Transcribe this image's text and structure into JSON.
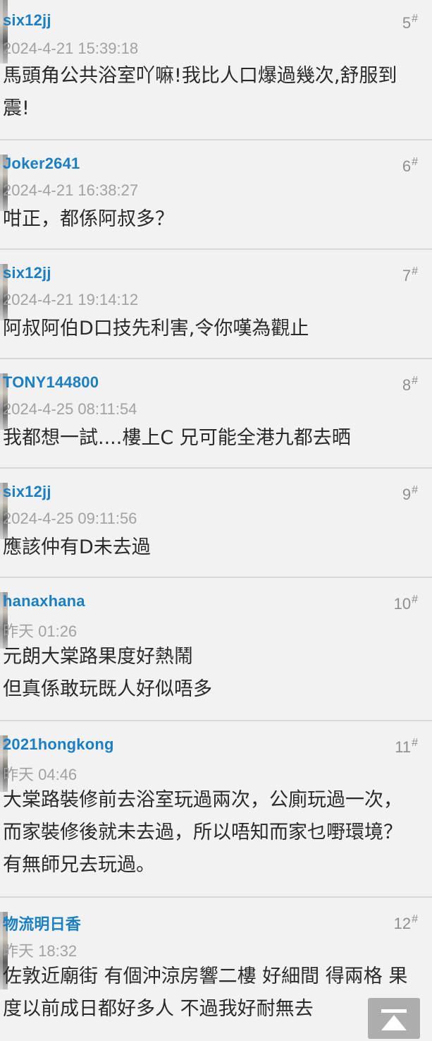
{
  "posts": [
    {
      "user": "six12jj",
      "floor": "5",
      "time": "2024-4-21 15:39:18",
      "content": "馬頭角公共浴室吖嘛!我比人口爆過幾次,舒服到震!"
    },
    {
      "user": "Joker2641",
      "floor": "6",
      "time": "2024-4-21 16:38:27",
      "content": "咁正，都係阿叔多？"
    },
    {
      "user": "six12jj",
      "floor": "7",
      "time": "2024-4-21 19:14:12",
      "content": "阿叔阿伯D口技先利害,令你嘆為觀止"
    },
    {
      "user": "TONY144800",
      "floor": "8",
      "time": "2024-4-25 08:11:54",
      "content": "我都想一試....樓上C 兄可能全港九都去晒"
    },
    {
      "user": "six12jj",
      "floor": "9",
      "time": "2024-4-25 09:11:56",
      "content": "應該仲有D未去過"
    },
    {
      "user": "hanaxhana",
      "floor": "10",
      "time": "昨天 01:26",
      "content": "元朗大棠路果度好熱鬧\n但真係敢玩既人好似唔多"
    },
    {
      "user": "2021hongkong",
      "floor": "11",
      "time": "昨天 04:46",
      "content": "大棠路裝修前去浴室玩過兩次，公廁玩過一次，而家裝修後就未去過，所以唔知而家乜嘢環境？有無師兄去玩過。"
    },
    {
      "user": "物流明日香",
      "floor": "12",
      "time": "昨天 18:32",
      "content": "佐敦近廟街 有個沖涼房響二樓 好細間 得兩格 果度以前成日都好多人 不過我好耐無去"
    }
  ],
  "floor_mark": "#",
  "scroll_top_icon": "scroll-to-top-icon"
}
